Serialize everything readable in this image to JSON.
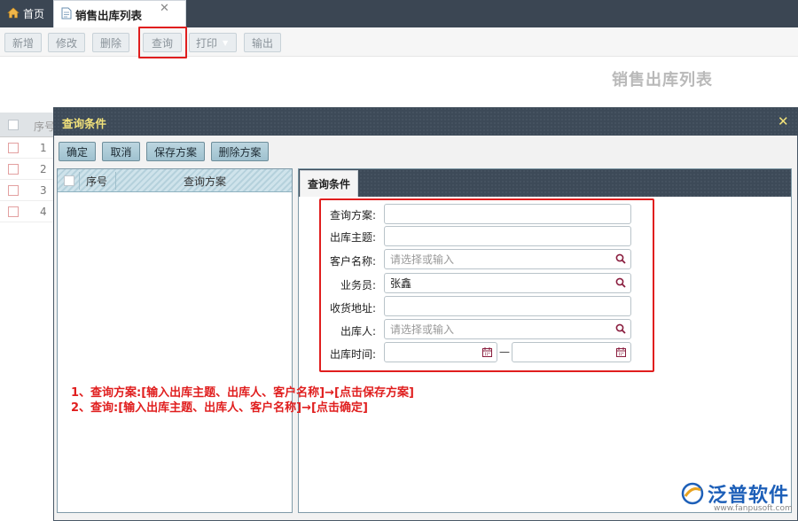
{
  "tabs": [
    {
      "label": "首页",
      "icon": "home-icon"
    },
    {
      "label": "销售出库列表",
      "icon": "document-icon",
      "active": true
    }
  ],
  "toolbar": {
    "add": "新增",
    "edit": "修改",
    "delete": "删除",
    "query": "查询",
    "print": "打印",
    "export": "输出"
  },
  "page_title": "销售出库列表",
  "bg_grid": {
    "col_seq": "序号",
    "rows": [
      "1",
      "2",
      "3",
      "4"
    ]
  },
  "dialog": {
    "title": "查询条件",
    "buttons": {
      "confirm": "确定",
      "cancel": "取消",
      "save_scheme": "保存方案",
      "delete_scheme": "删除方案"
    },
    "left_table": {
      "col_seq": "序号",
      "col_scheme": "查询方案"
    },
    "right_tab": "查询条件",
    "form": {
      "scheme_label": "查询方案:",
      "scheme_value": "",
      "subject_label": "出库主题:",
      "subject_value": "",
      "customer_label": "客户名称:",
      "customer_placeholder": "请选择或输入",
      "salesman_label": "业务员:",
      "salesman_value": "张鑫",
      "address_label": "收货地址:",
      "address_value": "",
      "outbound_person_label": "出库人:",
      "outbound_person_placeholder": "请选择或输入",
      "time_label": "出库时间:",
      "time_separator": "—"
    }
  },
  "annotations": {
    "line1": "1、查询方案:[输入出库主题、出库人、客户名称]→[点击保存方案]",
    "line2": "2、查询:[输入出库主题、出库人、客户名称]→[点击确定]"
  },
  "logo": {
    "text": "泛普软件",
    "url": "www.fanpusoft.com"
  },
  "colors": {
    "header_dark": "#3d4a58",
    "dialog_title": "#f2e27a",
    "highlight_red": "#e01e1e",
    "brand_blue": "#1d5fb8"
  }
}
